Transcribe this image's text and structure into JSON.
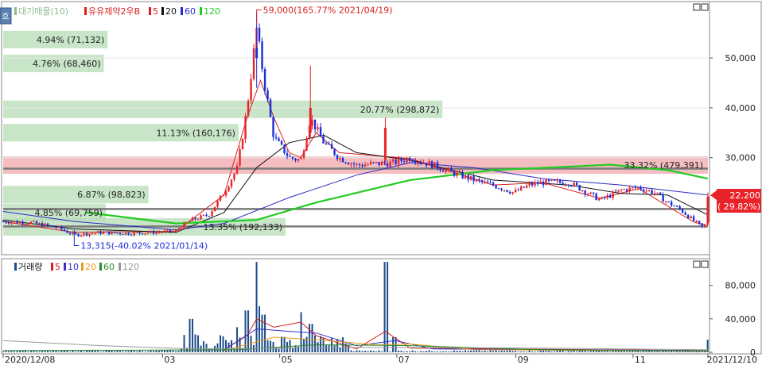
{
  "legend_price": {
    "volume_profile": "대기매물(10)",
    "stock_name": "유유제약2우B",
    "ma5": "5",
    "ma20": "20",
    "ma60": "60",
    "ma120": "120"
  },
  "legend_volume": {
    "title": "거래량",
    "ma5": "5",
    "ma10": "10",
    "ma20": "20",
    "ma60": "60",
    "ma120": "120"
  },
  "side_button": "호",
  "annotations": {
    "high": "59,000(165.77% 2021/04/19)",
    "low": "13,315(-40.02% 2021/01/14)",
    "current_price": "22,200",
    "current_change": "( 29.82%)"
  },
  "colors": {
    "up": "#e8232a",
    "down": "#1a2fd6",
    "ma5": "#d81f1f",
    "ma20": "#111111",
    "ma60": "#2a2ac8",
    "ma120": "#22cc22",
    "vma5": "#d81f1f",
    "vma10": "#3333cc",
    "vma20": "#e89a1a",
    "vma60": "#2a8a2a",
    "vma120": "#999999",
    "volume_bar": "#1b4b8a",
    "profile": "#b6dcb6",
    "profile_high": "#f0a8ac",
    "current_box": "#e8232a"
  },
  "chart_data": [
    {
      "type": "candlestick",
      "title": "유유제약2우B",
      "y_ticks": [
        "50,000",
        "40,000",
        "30,000"
      ],
      "y_tick_values": [
        50000,
        40000,
        30000
      ],
      "ylim": [
        11000,
        61000
      ],
      "x_labels": [
        "2020/12/08",
        "03",
        "05",
        "07",
        "09",
        "11",
        "2021/12/10"
      ],
      "x_label_dates": [
        "2020-12-08",
        "2021-03-01",
        "2021-05-01",
        "2021-07-01",
        "2021-09-01",
        "2021-11-01",
        "2021-12-10"
      ],
      "x_range": [
        "2020-12-08",
        "2021-12-10"
      ],
      "high": {
        "date": "2021-04-19",
        "value": 59000
      },
      "low": {
        "date": "2021-01-14",
        "value": 13315
      },
      "last": {
        "date": "2021-12-10",
        "value": 22200
      },
      "horizontal_lines": [
        27800,
        19700,
        16200
      ],
      "volume_profile": [
        {
          "label": "4.94% (71,132)",
          "price": 53700,
          "share": 4.94
        },
        {
          "label": "4.76% (68,460)",
          "price": 48900,
          "share": 4.76
        },
        {
          "label": "20.77% (298,872)",
          "price": 39700,
          "share": 20.77
        },
        {
          "label": "11.13% (160,176)",
          "price": 35000,
          "share": 11.13
        },
        {
          "label": "33.32% (479,391)",
          "price": 28500,
          "share": 33.32
        },
        {
          "label": "6.87% (98,823)",
          "price": 22600,
          "share": 6.87
        },
        {
          "label": "4.85% (69,759)",
          "price": 19000,
          "share": 4.85
        },
        {
          "label": "13.35% (192,133)",
          "price": 16100,
          "share": 13.35
        }
      ],
      "price_series": [
        [
          "2020-12-08",
          17200
        ],
        [
          "2020-12-22",
          17000
        ],
        [
          "2021-01-05",
          16000
        ],
        [
          "2021-01-14",
          14500
        ],
        [
          "2021-01-28",
          15000
        ],
        [
          "2021-02-10",
          14800
        ],
        [
          "2021-02-24",
          15000
        ],
        [
          "2021-03-08",
          15300
        ],
        [
          "2021-03-16",
          17500
        ],
        [
          "2021-03-25",
          18500
        ],
        [
          "2021-04-02",
          23000
        ],
        [
          "2021-04-09",
          28000
        ],
        [
          "2021-04-14",
          40000
        ],
        [
          "2021-04-19",
          56000
        ],
        [
          "2021-04-23",
          45000
        ],
        [
          "2021-04-28",
          34000
        ],
        [
          "2021-05-06",
          30000
        ],
        [
          "2021-05-12",
          29500
        ],
        [
          "2021-05-17",
          38000
        ],
        [
          "2021-05-24",
          33000
        ],
        [
          "2021-06-01",
          30000
        ],
        [
          "2021-06-10",
          28500
        ],
        [
          "2021-06-21",
          28800
        ],
        [
          "2021-06-30",
          29000
        ],
        [
          "2021-07-08",
          30000
        ],
        [
          "2021-07-20",
          28500
        ],
        [
          "2021-07-30",
          27000
        ],
        [
          "2021-08-10",
          25500
        ],
        [
          "2021-08-20",
          24500
        ],
        [
          "2021-08-31",
          23000
        ],
        [
          "2021-09-08",
          24500
        ],
        [
          "2021-09-15",
          25000
        ],
        [
          "2021-09-29",
          25000
        ],
        [
          "2021-10-08",
          23000
        ],
        [
          "2021-10-15",
          21500
        ],
        [
          "2021-10-26",
          23500
        ],
        [
          "2021-11-04",
          24000
        ],
        [
          "2021-11-12",
          23000
        ],
        [
          "2021-11-19",
          21000
        ],
        [
          "2021-11-26",
          19500
        ],
        [
          "2021-12-03",
          17200
        ],
        [
          "2021-12-08",
          15800
        ],
        [
          "2021-12-09",
          17100
        ],
        [
          "2021-12-10",
          22200
        ]
      ],
      "series": [
        {
          "name": "5",
          "points": [
            [
              "2020-12-08",
              17200
            ],
            [
              "2021-01-14",
              15000
            ],
            [
              "2021-03-08",
              15200
            ],
            [
              "2021-04-02",
              22500
            ],
            [
              "2021-04-14",
              38000
            ],
            [
              "2021-04-21",
              45500
            ],
            [
              "2021-04-28",
              38000
            ],
            [
              "2021-05-06",
              31000
            ],
            [
              "2021-05-12",
              30000
            ],
            [
              "2021-05-20",
              35000
            ],
            [
              "2021-06-01",
              31000
            ],
            [
              "2021-07-08",
              29800
            ],
            [
              "2021-08-20",
              24500
            ],
            [
              "2021-09-15",
              25000
            ],
            [
              "2021-10-15",
              21800
            ],
            [
              "2021-11-04",
              23800
            ],
            [
              "2021-12-03",
              17000
            ],
            [
              "2021-12-09",
              16500
            ]
          ]
        },
        {
          "name": "20",
          "points": [
            [
              "2020-12-08",
              17500
            ],
            [
              "2021-01-14",
              15700
            ],
            [
              "2021-03-08",
              15000
            ],
            [
              "2021-04-02",
              19000
            ],
            [
              "2021-04-19",
              28000
            ],
            [
              "2021-05-06",
              33000
            ],
            [
              "2021-05-24",
              34500
            ],
            [
              "2021-06-10",
              31000
            ],
            [
              "2021-07-08",
              29500
            ],
            [
              "2021-08-20",
              25500
            ],
            [
              "2021-09-29",
              24500
            ],
            [
              "2021-10-26",
              22800
            ],
            [
              "2021-11-19",
              22500
            ],
            [
              "2021-12-10",
              18500
            ]
          ]
        },
        {
          "name": "60",
          "points": [
            [
              "2020-12-08",
              19200
            ],
            [
              "2021-01-14",
              17200
            ],
            [
              "2021-03-08",
              15500
            ],
            [
              "2021-04-02",
              16800
            ],
            [
              "2021-05-06",
              22000
            ],
            [
              "2021-06-10",
              26500
            ],
            [
              "2021-07-08",
              29000
            ],
            [
              "2021-08-10",
              28000
            ],
            [
              "2021-09-15",
              25800
            ],
            [
              "2021-10-26",
              24500
            ],
            [
              "2021-12-10",
              22500
            ]
          ]
        },
        {
          "name": "120",
          "points": [
            [
              "2021-01-20",
              19000
            ],
            [
              "2021-03-08",
              16800
            ],
            [
              "2021-04-19",
              17500
            ],
            [
              "2021-05-20",
              21000
            ],
            [
              "2021-07-08",
              25500
            ],
            [
              "2021-08-20",
              27500
            ],
            [
              "2021-09-29",
              28200
            ],
            [
              "2021-10-20",
              28600
            ],
            [
              "2021-11-19",
              27500
            ],
            [
              "2021-12-10",
              25800
            ]
          ]
        }
      ]
    },
    {
      "type": "bar",
      "title": "거래량",
      "y_ticks": [
        "80,000",
        "40,000",
        "0"
      ],
      "y_tick_values": [
        80000,
        40000,
        0
      ],
      "ylim": [
        0,
        110000
      ],
      "x_range": [
        "2020-12-08",
        "2021-12-10"
      ],
      "volume_spikes": [
        [
          "2021-03-16",
          40000
        ],
        [
          "2021-04-09",
          30000
        ],
        [
          "2021-04-14",
          50000
        ],
        [
          "2021-04-19",
          108000
        ],
        [
          "2021-04-21",
          55000
        ],
        [
          "2021-04-23",
          45000
        ],
        [
          "2021-05-12",
          48000
        ],
        [
          "2021-05-17",
          34000
        ],
        [
          "2021-06-25",
          108000
        ],
        [
          "2021-06-30",
          18000
        ],
        [
          "2021-12-10",
          15000
        ]
      ],
      "series": [
        {
          "name": "5",
          "points": [
            [
              "2021-04-02",
              3000
            ],
            [
              "2021-04-14",
              20000
            ],
            [
              "2021-04-19",
              40000
            ],
            [
              "2021-04-28",
              30000
            ],
            [
              "2021-05-12",
              36000
            ],
            [
              "2021-05-20",
              20000
            ],
            [
              "2021-06-10",
              4000
            ],
            [
              "2021-06-25",
              25000
            ],
            [
              "2021-07-08",
              5000
            ],
            [
              "2021-12-10",
              2000
            ]
          ]
        },
        {
          "name": "10",
          "points": [
            [
              "2021-04-02",
              3000
            ],
            [
              "2021-04-19",
              28000
            ],
            [
              "2021-05-06",
              25000
            ],
            [
              "2021-05-20",
              23000
            ],
            [
              "2021-06-10",
              8000
            ],
            [
              "2021-06-30",
              14000
            ],
            [
              "2021-07-20",
              4000
            ],
            [
              "2021-12-10",
              2000
            ]
          ]
        },
        {
          "name": "20",
          "points": [
            [
              "2021-04-02",
              2000
            ],
            [
              "2021-04-28",
              18000
            ],
            [
              "2021-05-20",
              15000
            ],
            [
              "2021-06-21",
              9000
            ],
            [
              "2021-07-08",
              10000
            ],
            [
              "2021-08-10",
              3000
            ],
            [
              "2021-12-10",
              1500
            ]
          ]
        },
        {
          "name": "60",
          "points": [
            [
              "2020-12-08",
              2000
            ],
            [
              "2021-04-09",
              3000
            ],
            [
              "2021-05-20",
              9000
            ],
            [
              "2021-07-08",
              8000
            ],
            [
              "2021-09-15",
              3000
            ],
            [
              "2021-12-10",
              1500
            ]
          ]
        },
        {
          "name": "120",
          "points": [
            [
              "2020-12-08",
              14000
            ],
            [
              "2021-01-28",
              8000
            ],
            [
              "2021-03-16",
              4000
            ],
            [
              "2021-06-10",
              6000
            ],
            [
              "2021-09-15",
              5000
            ],
            [
              "2021-12-10",
              3000
            ]
          ]
        }
      ]
    }
  ]
}
